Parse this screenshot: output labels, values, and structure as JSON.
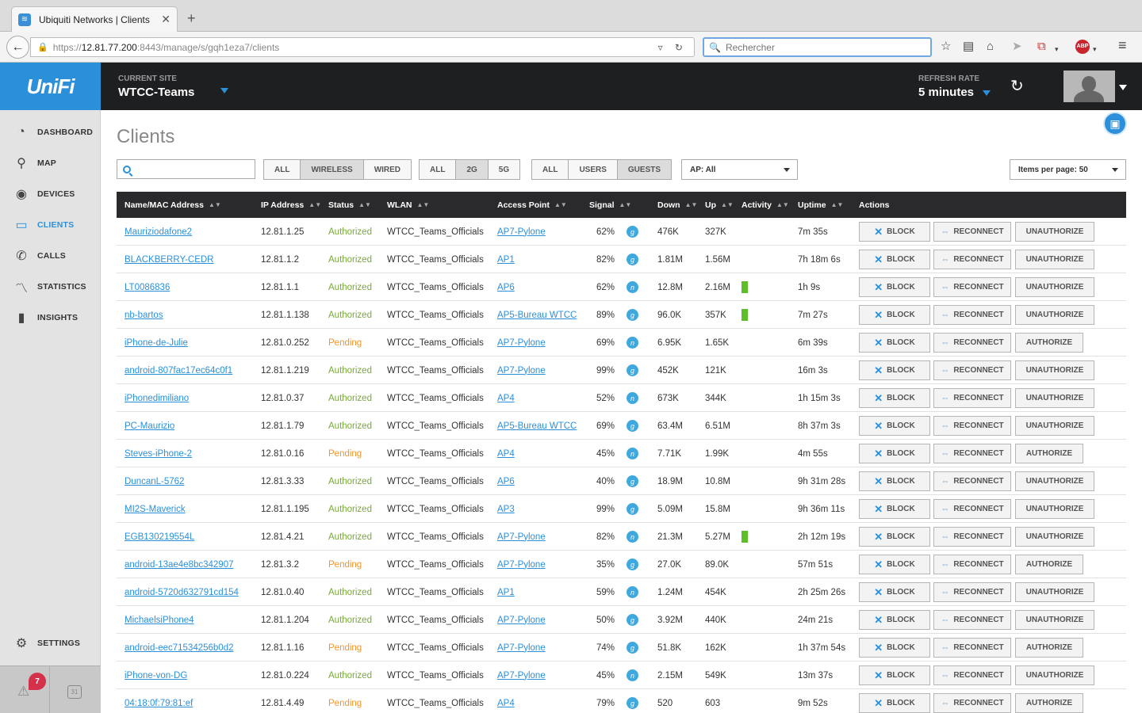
{
  "browser": {
    "tab_title": "Ubiquiti Networks | Clients",
    "url_prefix": "https://",
    "url_host": "12.81.77.200",
    "url_rest": ":8443/manage/s/gqh1eza7/clients",
    "search_placeholder": "Rechercher"
  },
  "header": {
    "logo": "UniFi",
    "site_label": "CURRENT SITE",
    "site_name": "WTCC-Teams",
    "refresh_label": "REFRESH RATE",
    "refresh_value": "5 minutes"
  },
  "sidebar": {
    "items": [
      {
        "label": "DASHBOARD"
      },
      {
        "label": "MAP"
      },
      {
        "label": "DEVICES"
      },
      {
        "label": "CLIENTS"
      },
      {
        "label": "CALLS"
      },
      {
        "label": "STATISTICS"
      },
      {
        "label": "INSIGHTS"
      }
    ],
    "settings": "SETTINGS",
    "alert_count": "7",
    "calendar_day": "31"
  },
  "main": {
    "title": "Clients",
    "filters": {
      "conn": [
        "ALL",
        "WIRELESS",
        "WIRED"
      ],
      "band": [
        "ALL",
        "2G",
        "5G"
      ],
      "user": [
        "ALL",
        "USERS",
        "GUESTS"
      ],
      "ap": "AP: All",
      "items_per_page": "Items per page: 50"
    },
    "columns": [
      "Name/MAC Address",
      "IP Address",
      "Status",
      "WLAN",
      "Access Point",
      "Signal",
      "Down",
      "Up",
      "Activity",
      "Uptime",
      "Actions"
    ],
    "actions": {
      "block": "BLOCK",
      "reconnect": "RECONNECT",
      "unauthorize": "UNAUTHORIZE",
      "authorize": "AUTHORIZE"
    }
  },
  "clients": [
    {
      "name": "Mauriziodafone2",
      "ip": "12.81.1.25",
      "status": "Authorized",
      "wlan": "WTCC_Teams_Officials",
      "ap": "AP7-Pylone",
      "signal": "62%",
      "radio": "g",
      "down": "476K",
      "up": "327K",
      "activity": 0,
      "uptime": "7m 35s"
    },
    {
      "name": "BLACKBERRY-CEDR",
      "ip": "12.81.1.2",
      "status": "Authorized",
      "wlan": "WTCC_Teams_Officials",
      "ap": "AP1",
      "signal": "82%",
      "radio": "g",
      "down": "1.81M",
      "up": "1.56M",
      "activity": 0,
      "uptime": "7h 18m 6s"
    },
    {
      "name": "LT0086836",
      "ip": "12.81.1.1",
      "status": "Authorized",
      "wlan": "WTCC_Teams_Officials",
      "ap": "AP6",
      "signal": "62%",
      "radio": "n",
      "down": "12.8M",
      "up": "2.16M",
      "activity": 1,
      "uptime": "1h 9s"
    },
    {
      "name": "nb-bartos",
      "ip": "12.81.1.138",
      "status": "Authorized",
      "wlan": "WTCC_Teams_Officials",
      "ap": "AP5-Bureau WTCC",
      "signal": "89%",
      "radio": "g",
      "down": "96.0K",
      "up": "357K",
      "activity": 1,
      "uptime": "7m 27s"
    },
    {
      "name": "iPhone-de-Julie",
      "ip": "12.81.0.252",
      "status": "Pending",
      "wlan": "WTCC_Teams_Officials",
      "ap": "AP7-Pylone",
      "signal": "69%",
      "radio": "n",
      "down": "6.95K",
      "up": "1.65K",
      "activity": 0,
      "uptime": "6m 39s"
    },
    {
      "name": "android-807fac17ec64c0f1",
      "ip": "12.81.1.219",
      "status": "Authorized",
      "wlan": "WTCC_Teams_Officials",
      "ap": "AP7-Pylone",
      "signal": "99%",
      "radio": "g",
      "down": "452K",
      "up": "121K",
      "activity": 0,
      "uptime": "16m 3s"
    },
    {
      "name": "iPhonedimiliano",
      "ip": "12.81.0.37",
      "status": "Authorized",
      "wlan": "WTCC_Teams_Officials",
      "ap": "AP4",
      "signal": "52%",
      "radio": "n",
      "down": "673K",
      "up": "344K",
      "activity": 0,
      "uptime": "1h 15m 3s"
    },
    {
      "name": "PC-Maurizio",
      "ip": "12.81.1.79",
      "status": "Authorized",
      "wlan": "WTCC_Teams_Officials",
      "ap": "AP5-Bureau WTCC",
      "signal": "69%",
      "radio": "g",
      "down": "63.4M",
      "up": "6.51M",
      "activity": 0,
      "uptime": "8h 37m 3s"
    },
    {
      "name": "Steves-iPhone-2",
      "ip": "12.81.0.16",
      "status": "Pending",
      "wlan": "WTCC_Teams_Officials",
      "ap": "AP4",
      "signal": "45%",
      "radio": "n",
      "down": "7.71K",
      "up": "1.99K",
      "activity": 0,
      "uptime": "4m 55s"
    },
    {
      "name": "DuncanL-5762",
      "ip": "12.81.3.33",
      "status": "Authorized",
      "wlan": "WTCC_Teams_Officials",
      "ap": "AP6",
      "signal": "40%",
      "radio": "g",
      "down": "18.9M",
      "up": "10.8M",
      "activity": 0,
      "uptime": "9h 31m 28s"
    },
    {
      "name": "MI2S-Maverick",
      "ip": "12.81.1.195",
      "status": "Authorized",
      "wlan": "WTCC_Teams_Officials",
      "ap": "AP3",
      "signal": "99%",
      "radio": "g",
      "down": "5.09M",
      "up": "15.8M",
      "activity": 0,
      "uptime": "9h 36m 11s"
    },
    {
      "name": "EGB130219554L",
      "ip": "12.81.4.21",
      "status": "Authorized",
      "wlan": "WTCC_Teams_Officials",
      "ap": "AP7-Pylone",
      "signal": "82%",
      "radio": "n",
      "down": "21.3M",
      "up": "5.27M",
      "activity": 1,
      "uptime": "2h 12m 19s"
    },
    {
      "name": "android-13ae4e8bc342907",
      "ip": "12.81.3.2",
      "status": "Pending",
      "wlan": "WTCC_Teams_Officials",
      "ap": "AP7-Pylone",
      "signal": "35%",
      "radio": "g",
      "down": "27.0K",
      "up": "89.0K",
      "activity": 0,
      "uptime": "57m 51s"
    },
    {
      "name": "android-5720d632791cd154",
      "ip": "12.81.0.40",
      "status": "Authorized",
      "wlan": "WTCC_Teams_Officials",
      "ap": "AP1",
      "signal": "59%",
      "radio": "n",
      "down": "1.24M",
      "up": "454K",
      "activity": 0,
      "uptime": "2h 25m 26s"
    },
    {
      "name": "MichaelsiPhone4",
      "ip": "12.81.1.204",
      "status": "Authorized",
      "wlan": "WTCC_Teams_Officials",
      "ap": "AP7-Pylone",
      "signal": "50%",
      "radio": "g",
      "down": "3.92M",
      "up": "440K",
      "activity": 0,
      "uptime": "24m 21s"
    },
    {
      "name": "android-eec71534256b0d2",
      "ip": "12.81.1.16",
      "status": "Pending",
      "wlan": "WTCC_Teams_Officials",
      "ap": "AP7-Pylone",
      "signal": "74%",
      "radio": "g",
      "down": "51.8K",
      "up": "162K",
      "activity": 0,
      "uptime": "1h 37m 54s"
    },
    {
      "name": "iPhone-von-DG",
      "ip": "12.81.0.224",
      "status": "Authorized",
      "wlan": "WTCC_Teams_Officials",
      "ap": "AP7-Pylone",
      "signal": "45%",
      "radio": "n",
      "down": "2.15M",
      "up": "549K",
      "activity": 0,
      "uptime": "13m 37s"
    },
    {
      "name": "04:18:0f:79:81:ef",
      "ip": "12.81.4.49",
      "status": "Pending",
      "wlan": "WTCC_Teams_Officials",
      "ap": "AP4",
      "signal": "79%",
      "radio": "g",
      "down": "520",
      "up": "603",
      "activity": 0,
      "uptime": "9m 52s"
    }
  ]
}
